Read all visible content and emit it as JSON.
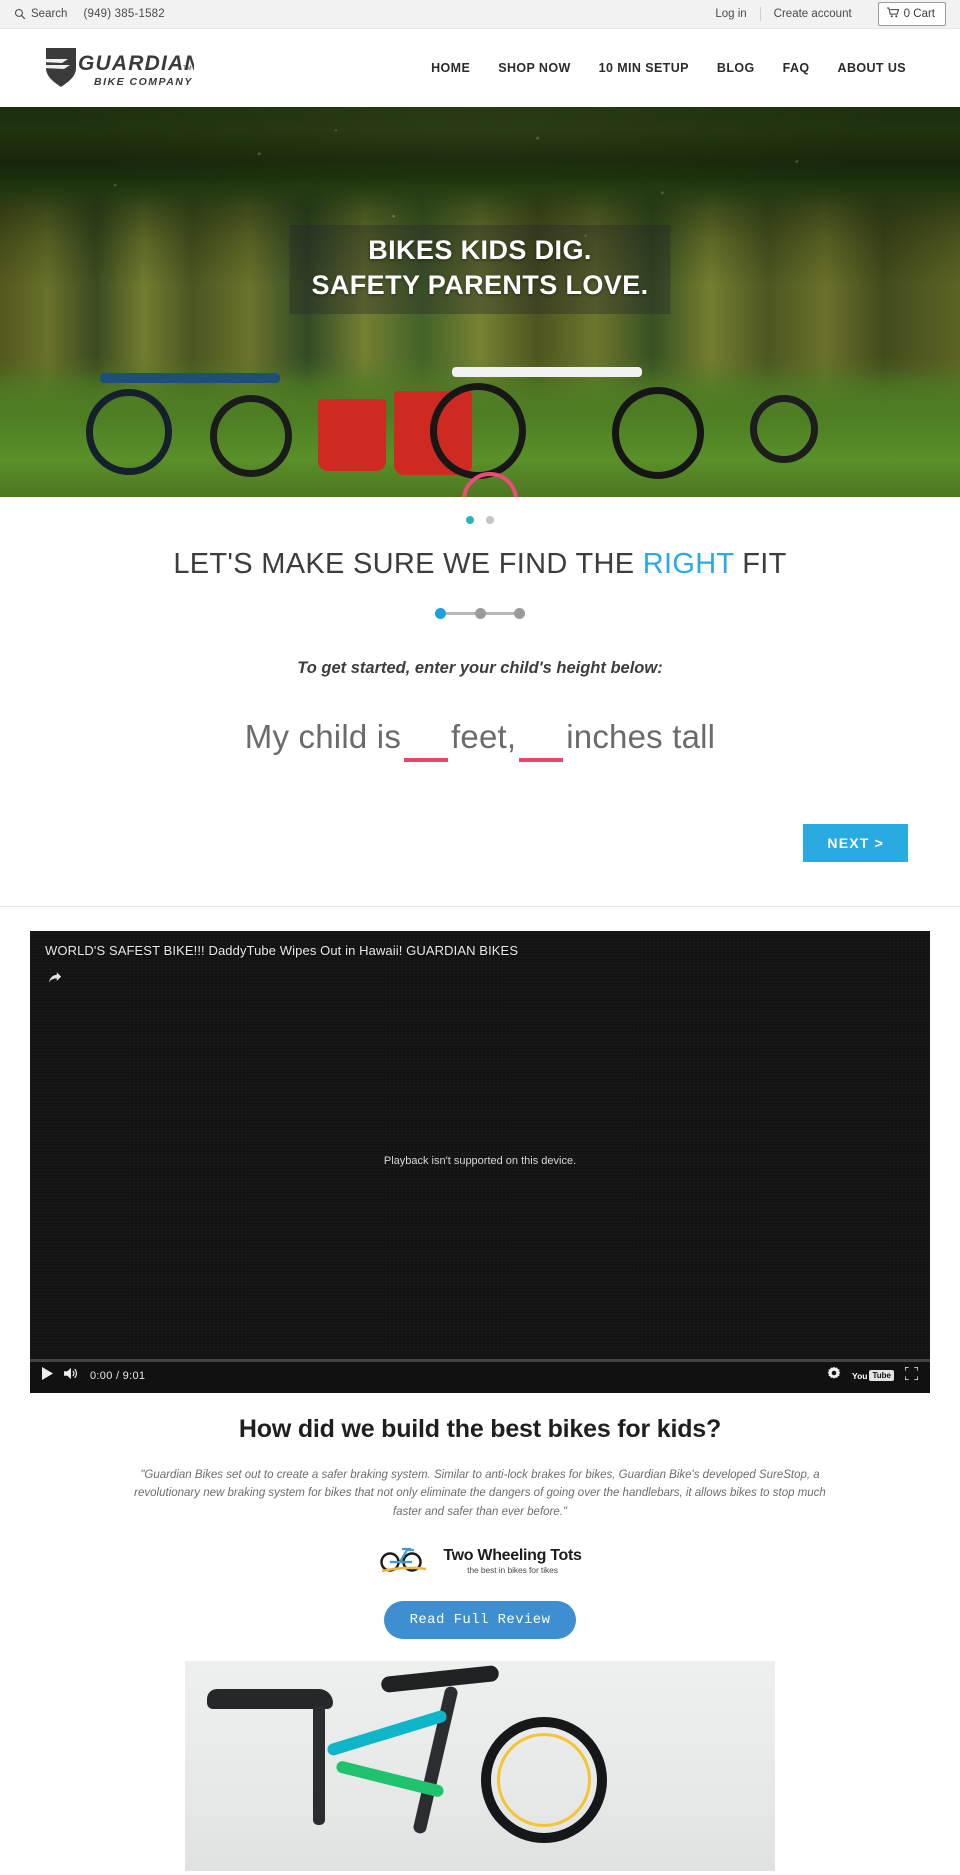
{
  "topbar": {
    "search_label": "Search",
    "search_icon": "search-icon",
    "phone": "(949) 385-1582",
    "login_label": "Log in",
    "create_account_label": "Create account",
    "cart_icon": "cart-icon",
    "cart_label": "0 Cart"
  },
  "header": {
    "logo_name": "GUARDIAN",
    "logo_tm": "TM",
    "logo_sub": "BIKE COMPANY",
    "nav": [
      {
        "label": "HOME"
      },
      {
        "label": "SHOP NOW"
      },
      {
        "label": "10 MIN SETUP"
      },
      {
        "label": "BLOG"
      },
      {
        "label": "FAQ"
      },
      {
        "label": "ABOUT US"
      }
    ]
  },
  "hero": {
    "line1": "BIKES KIDS DIG.",
    "line2": "SAFETY PARENTS LOVE.",
    "dots": [
      {
        "active": true
      },
      {
        "active": false
      }
    ]
  },
  "fit": {
    "title_before": "LET'S MAKE SURE WE FIND THE ",
    "title_highlight": "RIGHT",
    "title_after": " FIT",
    "highlight_color": "#29abe2",
    "steps": [
      {
        "active": true
      },
      {
        "active": false
      },
      {
        "active": false
      }
    ],
    "subtitle": "To get started, enter your child's height below:",
    "sentence_1": "My child is",
    "feet_value": "",
    "feet_placeholder": "",
    "sentence_2": "feet,",
    "inches_value": "",
    "inches_placeholder": "",
    "sentence_3": "inches tall",
    "underline_color": "#e8456a",
    "next_label": "NEXT >"
  },
  "video": {
    "title": "WORLD'S SAFEST BIKE!!! DaddyTube Wipes Out in Hawaii! GUARDIAN BIKES",
    "share_icon": "share-icon",
    "message": "Playback isn't supported on this device.",
    "play_icon": "play-icon",
    "volume_icon": "volume-icon",
    "time": "0:00 / 9:01",
    "settings_icon": "gear-icon",
    "youtube_label_1": "You",
    "youtube_label_2": "Tube",
    "fullscreen_icon": "fullscreen-icon"
  },
  "review": {
    "heading": "How did we build the best bikes for kids?",
    "quote": "\"Guardian Bikes set out to create a safer braking system.  Similar to anti-lock brakes for bikes, Guardian Bike's developed SureStop, a revolutionary new braking system for bikes that not only eliminate the dangers of going over the handlebars, it allows bikes to stop much faster and safer than ever before.\"",
    "logo_title": "Two Wheeling Tots",
    "logo_tagline": "the best in bikes for tikes",
    "button_label": "Read Full Review"
  }
}
